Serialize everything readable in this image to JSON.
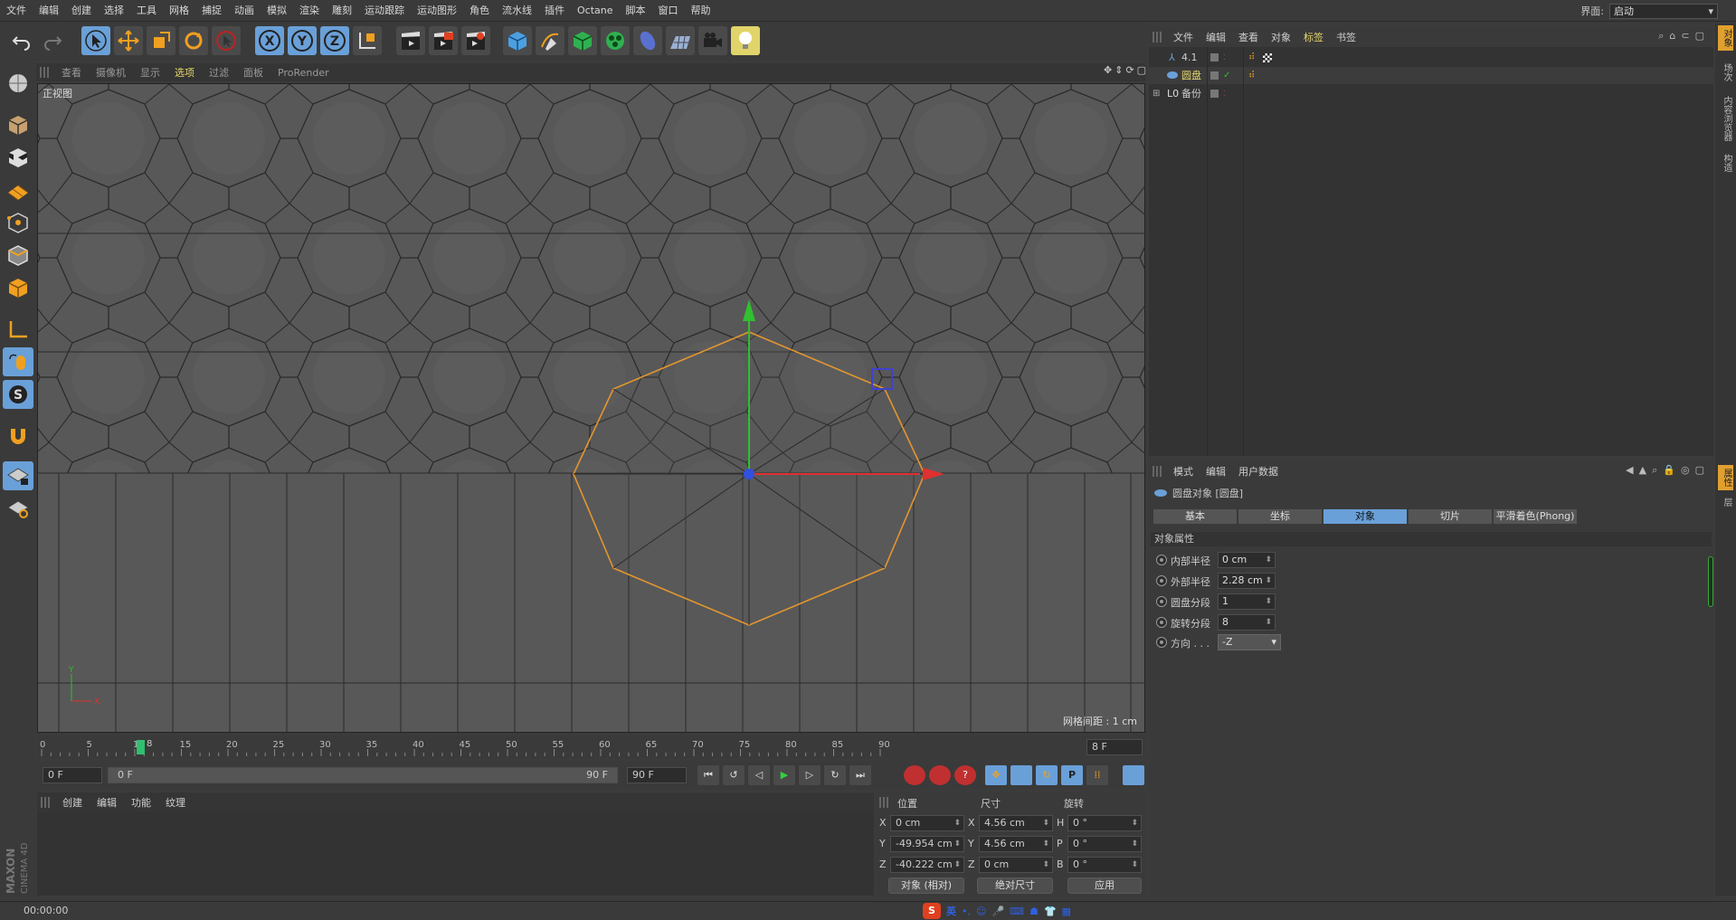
{
  "menubar": {
    "items": [
      "文件",
      "编辑",
      "创建",
      "选择",
      "工具",
      "网格",
      "捕捉",
      "动画",
      "模拟",
      "渲染",
      "雕刻",
      "运动跟踪",
      "运动图形",
      "角色",
      "流水线",
      "插件",
      "Octane",
      "脚本",
      "窗口",
      "帮助"
    ],
    "layout_label": "界面:",
    "layout_value": "启动"
  },
  "viewport": {
    "menu": [
      "查看",
      "摄像机",
      "显示",
      "选项",
      "过滤",
      "面板",
      "ProRender"
    ],
    "active_menu": "选项",
    "label": "正视图",
    "grid_distance": "网格间距 : 1 cm"
  },
  "timeline": {
    "ticks": [
      "0",
      "5",
      "10",
      "15",
      "20",
      "25",
      "30",
      "35",
      "40",
      "45",
      "50",
      "55",
      "60",
      "65",
      "70",
      "75",
      "80",
      "85",
      "90"
    ],
    "current_frame_marker": "8",
    "current_frame_field": "8 F",
    "start_field": "0 F",
    "range_start": "0 F",
    "range_end": "90 F",
    "end_field": "90 F"
  },
  "material_menu": [
    "创建",
    "编辑",
    "功能",
    "纹理"
  ],
  "coordinates": {
    "headers": [
      "位置",
      "尺寸",
      "旋转"
    ],
    "rows": [
      {
        "axis": "X",
        "pos": "0 cm",
        "size_axis": "X",
        "size": "4.56 cm",
        "rot_axis": "H",
        "rot": "0 °"
      },
      {
        "axis": "Y",
        "pos": "-49.954 cm",
        "size_axis": "Y",
        "size": "4.56 cm",
        "rot_axis": "P",
        "rot": "0 °"
      },
      {
        "axis": "Z",
        "pos": "-40.222 cm",
        "size_axis": "Z",
        "size": "0 cm",
        "rot_axis": "B",
        "rot": "0 °"
      }
    ],
    "mode_select": "对象 (相对)",
    "size_select": "绝对尺寸",
    "apply": "应用"
  },
  "status": {
    "time": "00:00:00",
    "ime_lang": "英"
  },
  "object_manager": {
    "menu": [
      "文件",
      "编辑",
      "查看",
      "对象",
      "标签",
      "书签"
    ],
    "active_menu": "标签",
    "objects": [
      {
        "name": "4.1"
      },
      {
        "name": "圆盘"
      },
      {
        "name": "备份"
      }
    ]
  },
  "attribute_manager": {
    "menu": [
      "模式",
      "编辑",
      "用户数据"
    ],
    "object_title": "圆盘对象 [圆盘]",
    "tabs": [
      "基本",
      "坐标",
      "对象",
      "切片",
      "平滑着色(Phong)"
    ],
    "active_tab": "对象",
    "section": "对象属性",
    "props": [
      {
        "label": "内部半径",
        "value": "0 cm"
      },
      {
        "label": "外部半径",
        "value": "2.28 cm"
      },
      {
        "label": "圆盘分段",
        "value": "1"
      },
      {
        "label": "旋转分段",
        "value": "8"
      },
      {
        "label": "方向 . . .",
        "value": "-Z"
      }
    ]
  },
  "maxon": {
    "brand": "MAXON",
    "product": "CINEMA 4D"
  },
  "right_tabs": [
    "对象",
    "场次",
    "内容浏览器",
    "构造"
  ],
  "right_tabs_lower": [
    "属性",
    "层"
  ],
  "colors": {
    "accent_blue": "#6aa0d8",
    "active_yellow": "#e6d66a",
    "object_orange": "#e2962f",
    "axis_red": "#e03030",
    "axis_green": "#30c030",
    "axis_blue": "#3050e0"
  }
}
